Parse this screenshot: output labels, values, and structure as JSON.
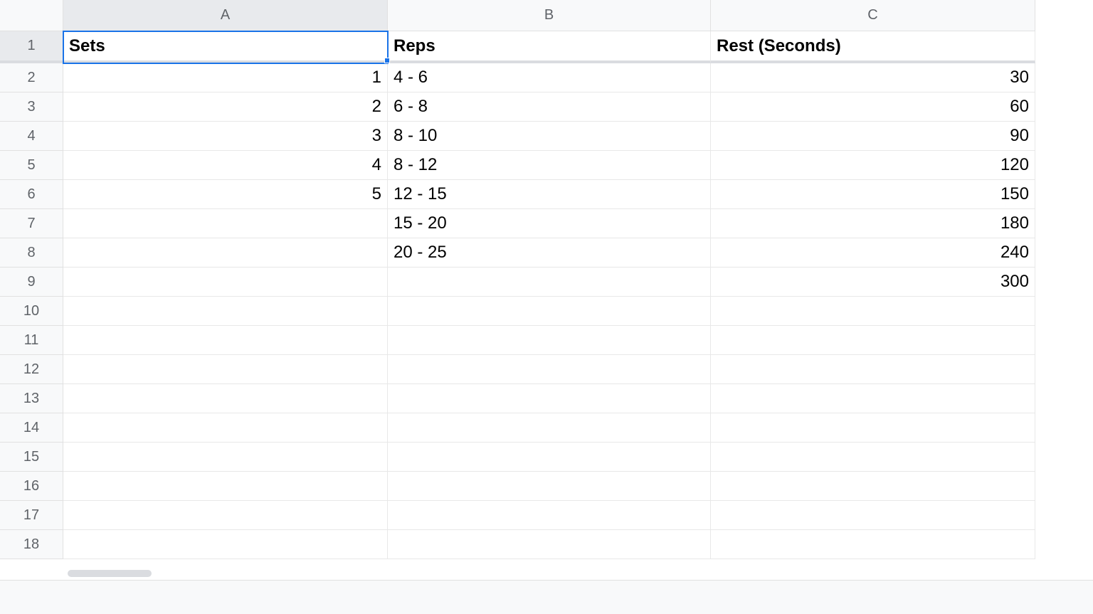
{
  "columns": [
    "A",
    "B",
    "C"
  ],
  "rowCount": 18,
  "headers": {
    "A": "Sets",
    "B": "Reps",
    "C": "Rest (Seconds)"
  },
  "data": {
    "A": [
      "1",
      "2",
      "3",
      "4",
      "5",
      "",
      "",
      "",
      "",
      "",
      "",
      "",
      "",
      "",
      "",
      "",
      ""
    ],
    "B": [
      "4 - 6",
      "6 - 8",
      "8 - 10",
      "8 - 12",
      "12 - 15",
      "15 - 20",
      "20 - 25",
      "",
      "",
      "",
      "",
      "",
      "",
      "",
      "",
      "",
      ""
    ],
    "C": [
      "30",
      "60",
      "90",
      "120",
      "150",
      "180",
      "240",
      "300",
      "",
      "",
      "",
      "",
      "",
      "",
      "",
      "",
      ""
    ]
  },
  "selectedCell": "A1"
}
